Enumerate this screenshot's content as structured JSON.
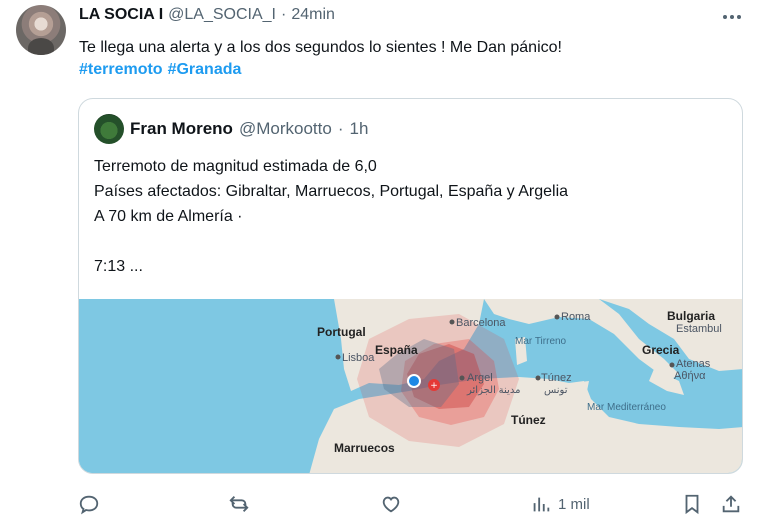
{
  "tweet": {
    "name": "LA SOCIA I",
    "handle": "@LA_SOCIA_I",
    "separator": "·",
    "time": "24min",
    "text": "Te llega una alerta y a los dos segundos lo sientes ! Me Dan pánico!",
    "hashtags": [
      "#terremoto",
      "#Granada"
    ]
  },
  "quoted": {
    "name": "Fran Moreno",
    "handle": "@Morkootto",
    "separator": "·",
    "time": "1h",
    "lines": [
      "Terremoto de magnitud estimada de 6,0",
      "Países afectados: Gibraltar, Marruecos, Portugal, España y Argelia",
      "A 70 km de Almería ·"
    ],
    "footer": "7:13 ..."
  },
  "map": {
    "labels": {
      "portugal": "Portugal",
      "lisboa": "Lisboa",
      "espana": "España",
      "barcelona": "Barcelona",
      "roma": "Roma",
      "mar_tirreno": "Mar Tirreno",
      "bulgaria": "Bulgaria",
      "estambul": "Estambul",
      "grecia": "Grecia",
      "atenas": "Atenas",
      "atenas_greek": "Αθήνα",
      "argel": "Argel",
      "argel_arabic": "مدينة الجزائر",
      "tunez_city": "Túnez",
      "tunez_arabic": "تونس",
      "tunez_country": "Túnez",
      "mar_mediterraneo": "Mar Mediterráneo",
      "marruecos": "Marruecos"
    },
    "colors": {
      "sea": "#7ec8e3",
      "land": "#ece7de",
      "quake": "#e53935"
    }
  },
  "actions": {
    "reply_icon": "reply-icon",
    "retweet_icon": "retweet-icon",
    "like_icon": "heart-icon",
    "views_icon": "views-icon",
    "views_count": "1 mil",
    "bookmark_icon": "bookmark-icon",
    "share_icon": "share-icon"
  }
}
